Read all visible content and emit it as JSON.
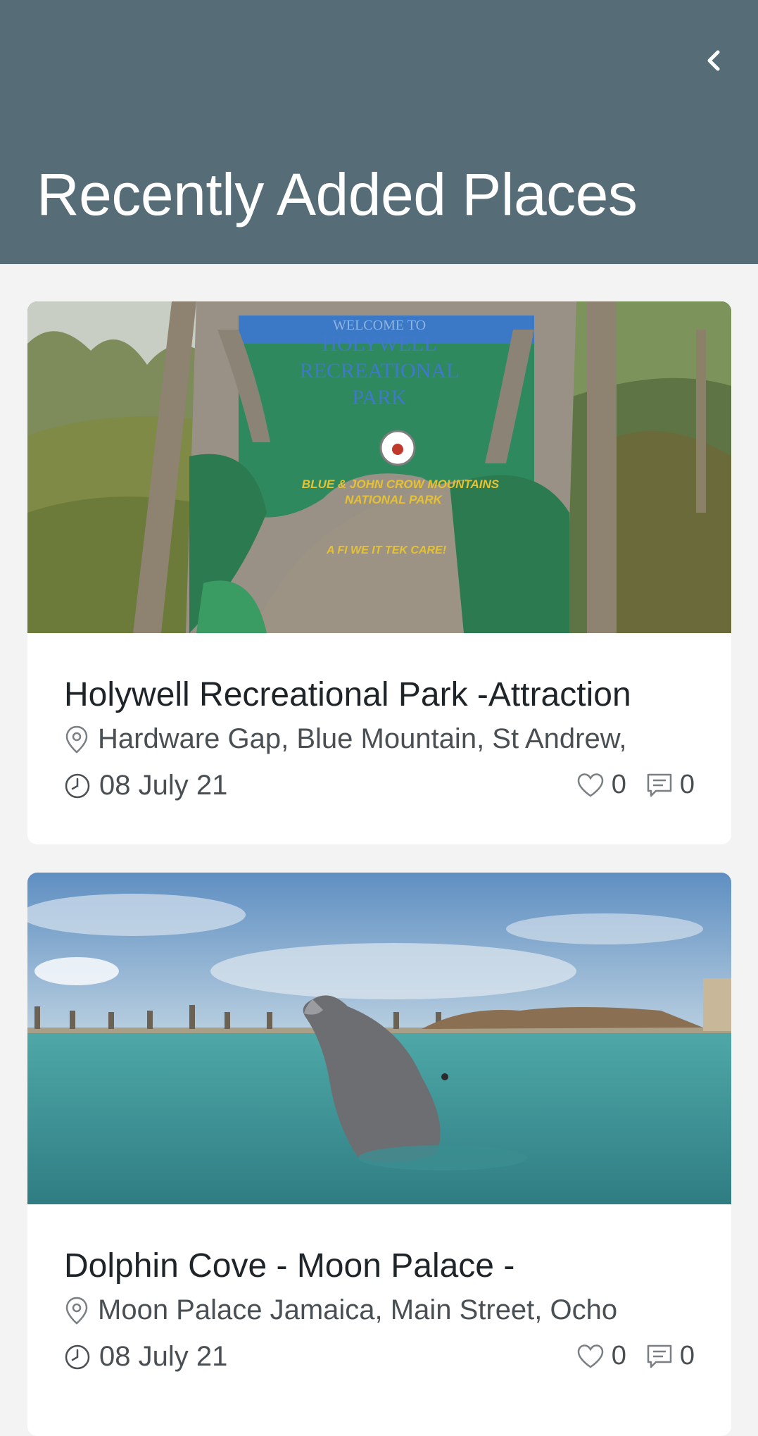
{
  "header": {
    "title": "Recently Added Places",
    "back_icon": "chevron-left-icon",
    "background": "#566d78"
  },
  "places": [
    {
      "title": "Holywell Recreational Park -Attraction",
      "address": "Hardware Gap, Blue Mountain, St Andrew,",
      "date": "08 July 21",
      "likes": "0",
      "comments": "0",
      "image_desc": "Holywell Recreational Park sign",
      "sign_text": {
        "line1": "WELCOME TO",
        "line2": "HOLYWELL",
        "line3": "RECREATIONAL",
        "line4": "PARK",
        "line5": "BLUE & JOHN CROW MOUNTAINS",
        "line6": "NATIONAL PARK",
        "line7": "A FI WE IT  TEK CARE!"
      }
    },
    {
      "title": "Dolphin Cove - Moon Palace -",
      "address": "Moon Palace Jamaica, Main Street, Ocho",
      "date": "08 July 21",
      "likes": "0",
      "comments": "0",
      "image_desc": "dolphin in a lagoon"
    }
  ]
}
